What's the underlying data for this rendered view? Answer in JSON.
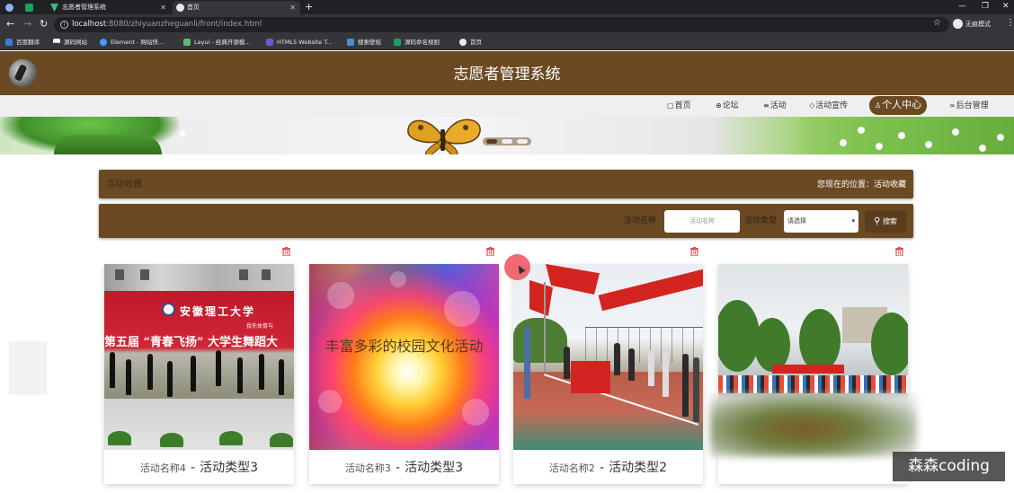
{
  "browser": {
    "tabs": [
      {
        "label": "",
        "active": false
      },
      {
        "label": "志愿者管理系统",
        "active": false
      },
      {
        "label": "首页",
        "active": true
      }
    ],
    "url_host": "localhost",
    "url_rest": ":8080/zhiyuanzheguanli/front/index.html",
    "profile_label": "无痕模式",
    "bookmarks": [
      "百度翻译",
      "源码网站",
      "Element - 网站快...",
      "Layui - 经典开源模...",
      "HTML5 Website T...",
      "搜索壁纸",
      "源码命名规则",
      "首页"
    ]
  },
  "site": {
    "title": "志愿者管理系统"
  },
  "nav": {
    "items": [
      "首页",
      "论坛",
      "活动",
      "活动宣传",
      "个人中心",
      "后台管理"
    ],
    "active_index": 4
  },
  "breadcrumb": {
    "title": "活动收藏",
    "location": "您现在的位置：活动收藏"
  },
  "search": {
    "name_label": "活动名称",
    "name_placeholder": "活动名称",
    "type_label": "活动类型",
    "type_selected": "请选择",
    "button_label": "搜索"
  },
  "cards": [
    {
      "name": "活动名称4",
      "dash": "-",
      "type": "活动类型3"
    },
    {
      "name": "活动名称3",
      "dash": "-",
      "type": "活动类型3",
      "image_text": "丰富多彩的校园文化活动"
    },
    {
      "name": "活动名称2",
      "dash": "-",
      "type": "活动类型2"
    },
    {
      "name": "",
      "dash": "",
      "type": ""
    }
  ],
  "card1_image": {
    "school": "安徽理工大学",
    "title": "“青春飞扬”",
    "subtitle": "第五届 “青春飞扬” 大学生舞蹈大",
    "tag": "我先体育与"
  },
  "watermark": "森森coding",
  "colors": {
    "brand_brown": "#6b4a23",
    "dark_brown": "#5a3d1c",
    "trash_red": "#e05252"
  }
}
